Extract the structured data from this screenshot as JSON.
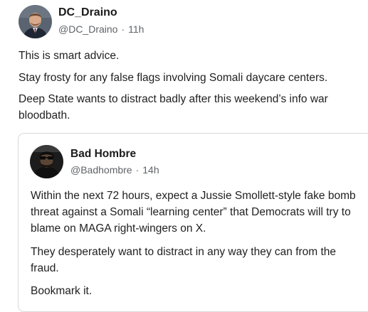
{
  "post": {
    "author": {
      "display_name": "DC_Draino",
      "handle": "@DC_Draino",
      "separator": "·",
      "time": "11h",
      "avatar_icon": "user-avatar-icon"
    },
    "paragraphs": [
      "This is smart advice.",
      "Stay frosty for any false flags involving Somali daycare centers.",
      "Deep State wants to distract badly after this weekend’s info war bloodbath."
    ]
  },
  "quoted_post": {
    "author": {
      "display_name": "Bad Hombre",
      "handle": "@Badhombre",
      "separator": "·",
      "time": "14h",
      "avatar_icon": "user-avatar-icon"
    },
    "paragraphs": [
      "Within the next 72 hours, expect a Jussie Smollett-style fake bomb threat against a Somali “learning center” that Democrats will try to blame on MAGA right-wingers on X.",
      "They desperately want to distract in any way they can from the fraud.",
      "Bookmark it."
    ]
  },
  "colors": {
    "text": "#1f1f1f",
    "muted": "#5f6368",
    "border": "#d7d9dc",
    "background": "#ffffff"
  }
}
